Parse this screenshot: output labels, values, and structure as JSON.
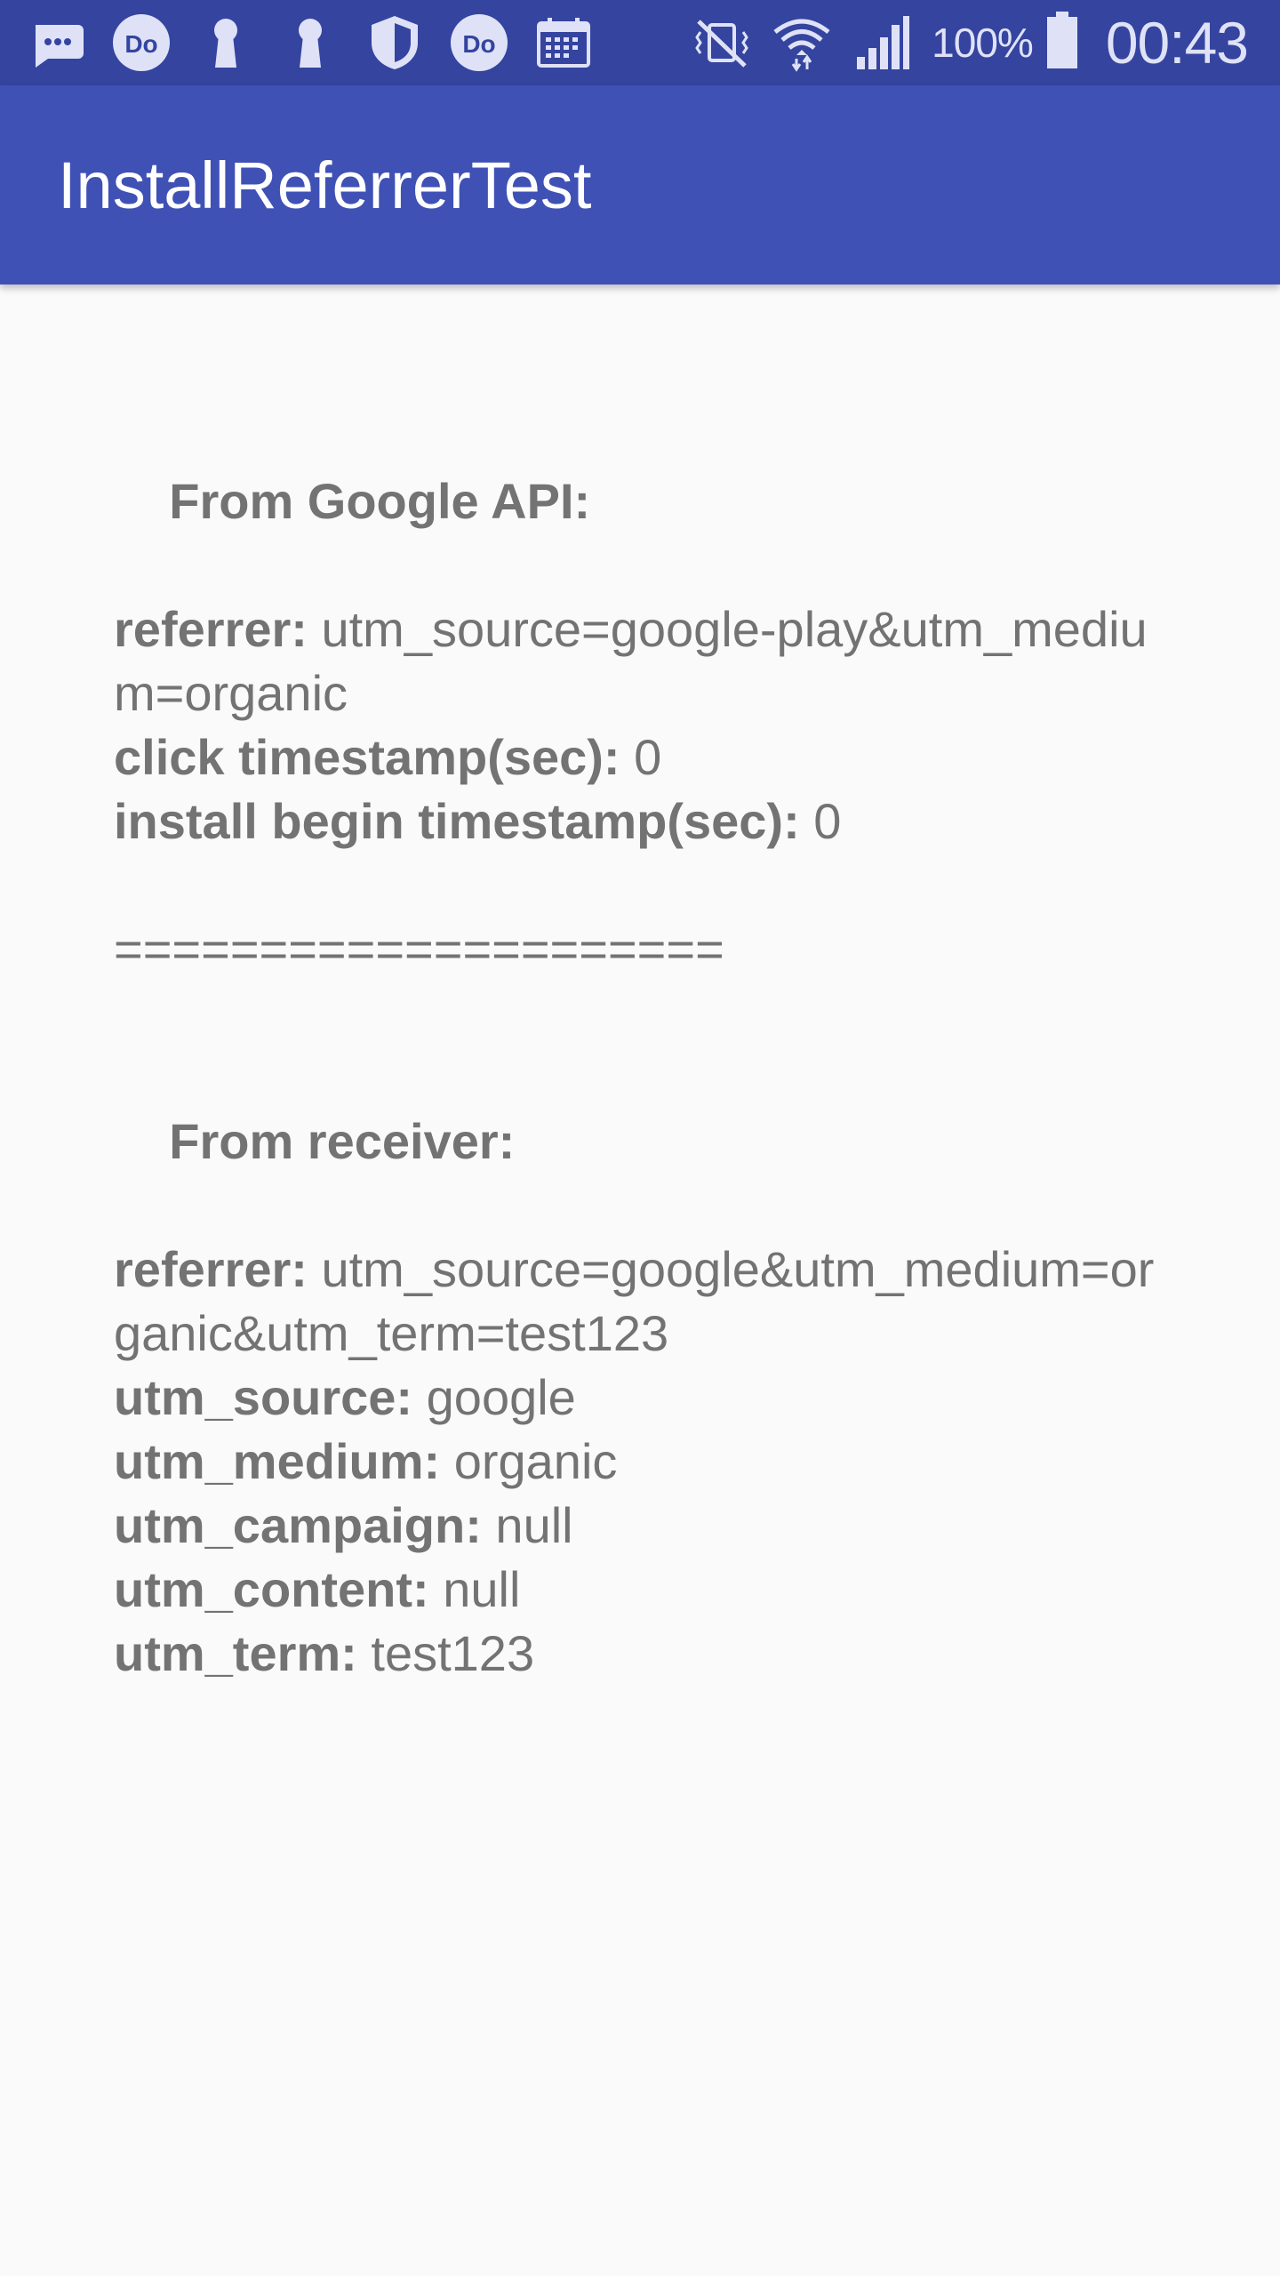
{
  "status_bar": {
    "left_icons": [
      "messages-icon",
      "do-app-icon",
      "keyhole-icon",
      "keyhole-icon",
      "shield-icon",
      "do-app-icon",
      "calendar-icon"
    ],
    "do_badge_text": "Do",
    "right_icons": [
      "mute-vibrate-icon",
      "wifi-icon",
      "signal-icon"
    ],
    "battery_percent": "100%",
    "battery_level": 1.0,
    "time": "00:43"
  },
  "app_bar": {
    "title": "InstallReferrerTest",
    "background": "#3f51b5",
    "status_bar_color": "#34449f"
  },
  "content": {
    "google_api": {
      "heading": "From Google API:",
      "referrer_label": "referrer:",
      "referrer_value": " utm_source=google-play&utm_medium=organic",
      "click_label": "click timestamp(sec):",
      "click_value": " 0",
      "install_label": "install begin timestamp(sec):",
      "install_value": " 0"
    },
    "separator": "=====================",
    "receiver": {
      "heading": "From receiver:",
      "referrer_label": "referrer:",
      "referrer_value": " utm_source=google&utm_medium=organic&utm_term=test123",
      "source_label": "utm_source:",
      "source_value": " google",
      "medium_label": "utm_medium:",
      "medium_value": " organic",
      "campaign_label": "utm_campaign:",
      "campaign_value": " null",
      "content_label": "utm_content:",
      "content_value": " null",
      "term_label": "utm_term:",
      "term_value": " test123"
    }
  }
}
